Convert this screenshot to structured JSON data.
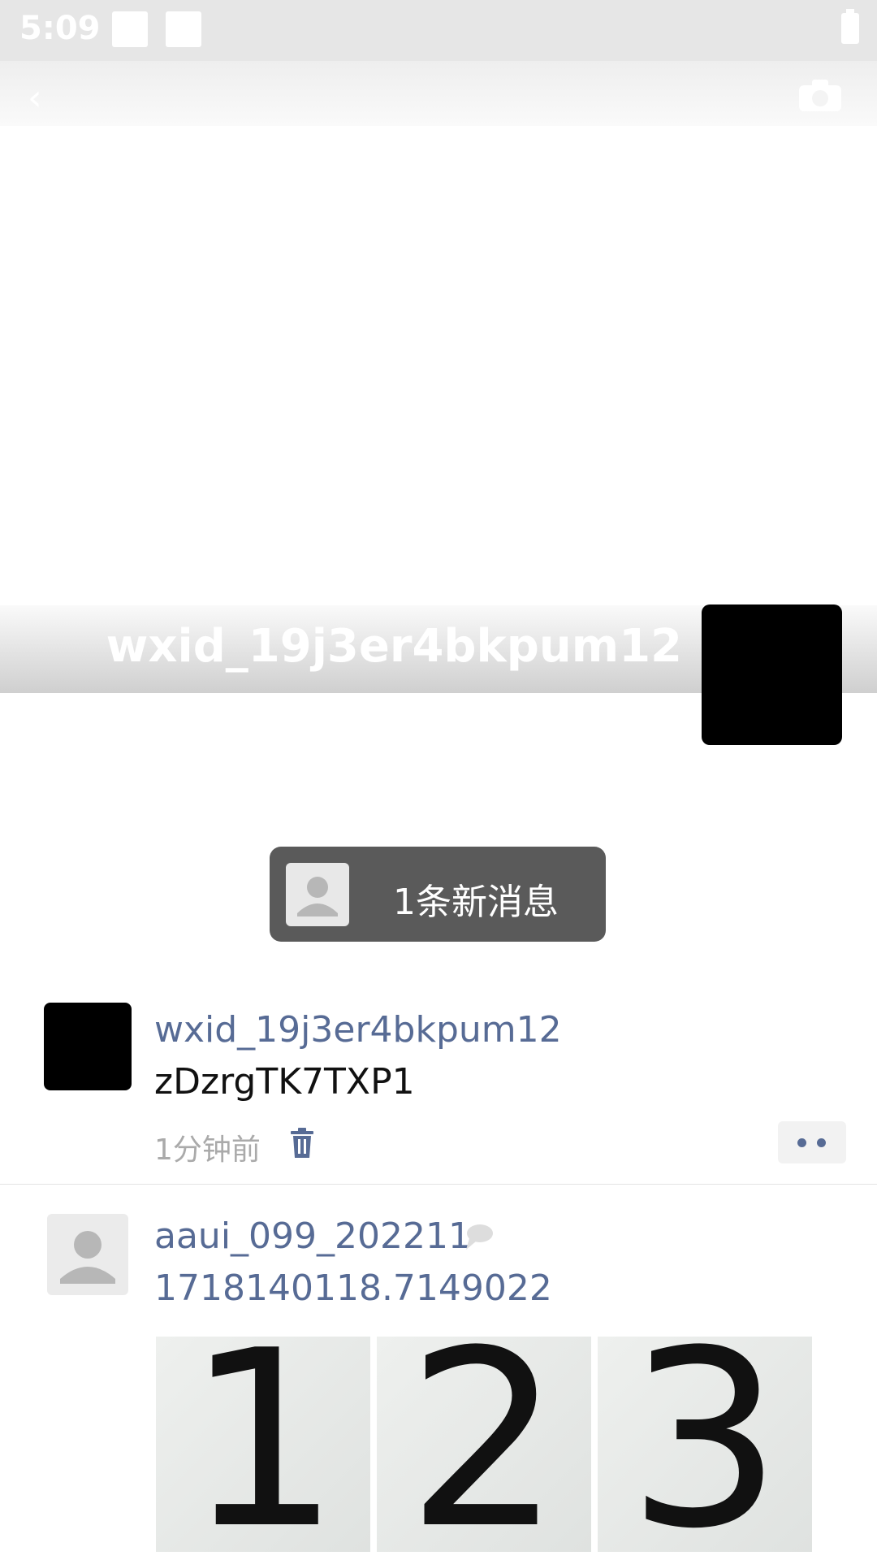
{
  "status_bar": {
    "time": "5:09"
  },
  "profile": {
    "cover_name": "wxid_19j3er4bkpum12"
  },
  "new_message_banner": {
    "text": "1条新消息"
  },
  "posts": [
    {
      "username": "wxid_19j3er4bkpum12",
      "content": "zDzrgTK7TXP1",
      "time": "1分钟前"
    },
    {
      "username": "aaui_099_202211",
      "content": "1718140118.7149022",
      "photos": [
        "1",
        "2",
        "3"
      ]
    }
  ],
  "icons": {
    "back": "back-arrow-icon",
    "camera": "camera-icon",
    "trash": "trash-icon",
    "more": "more-dots-icon",
    "comment": "comment-bubble-icon",
    "default_avatar": "default-avatar-icon"
  },
  "colors": {
    "link": "#576b95",
    "banner": "#5a5a5a"
  }
}
